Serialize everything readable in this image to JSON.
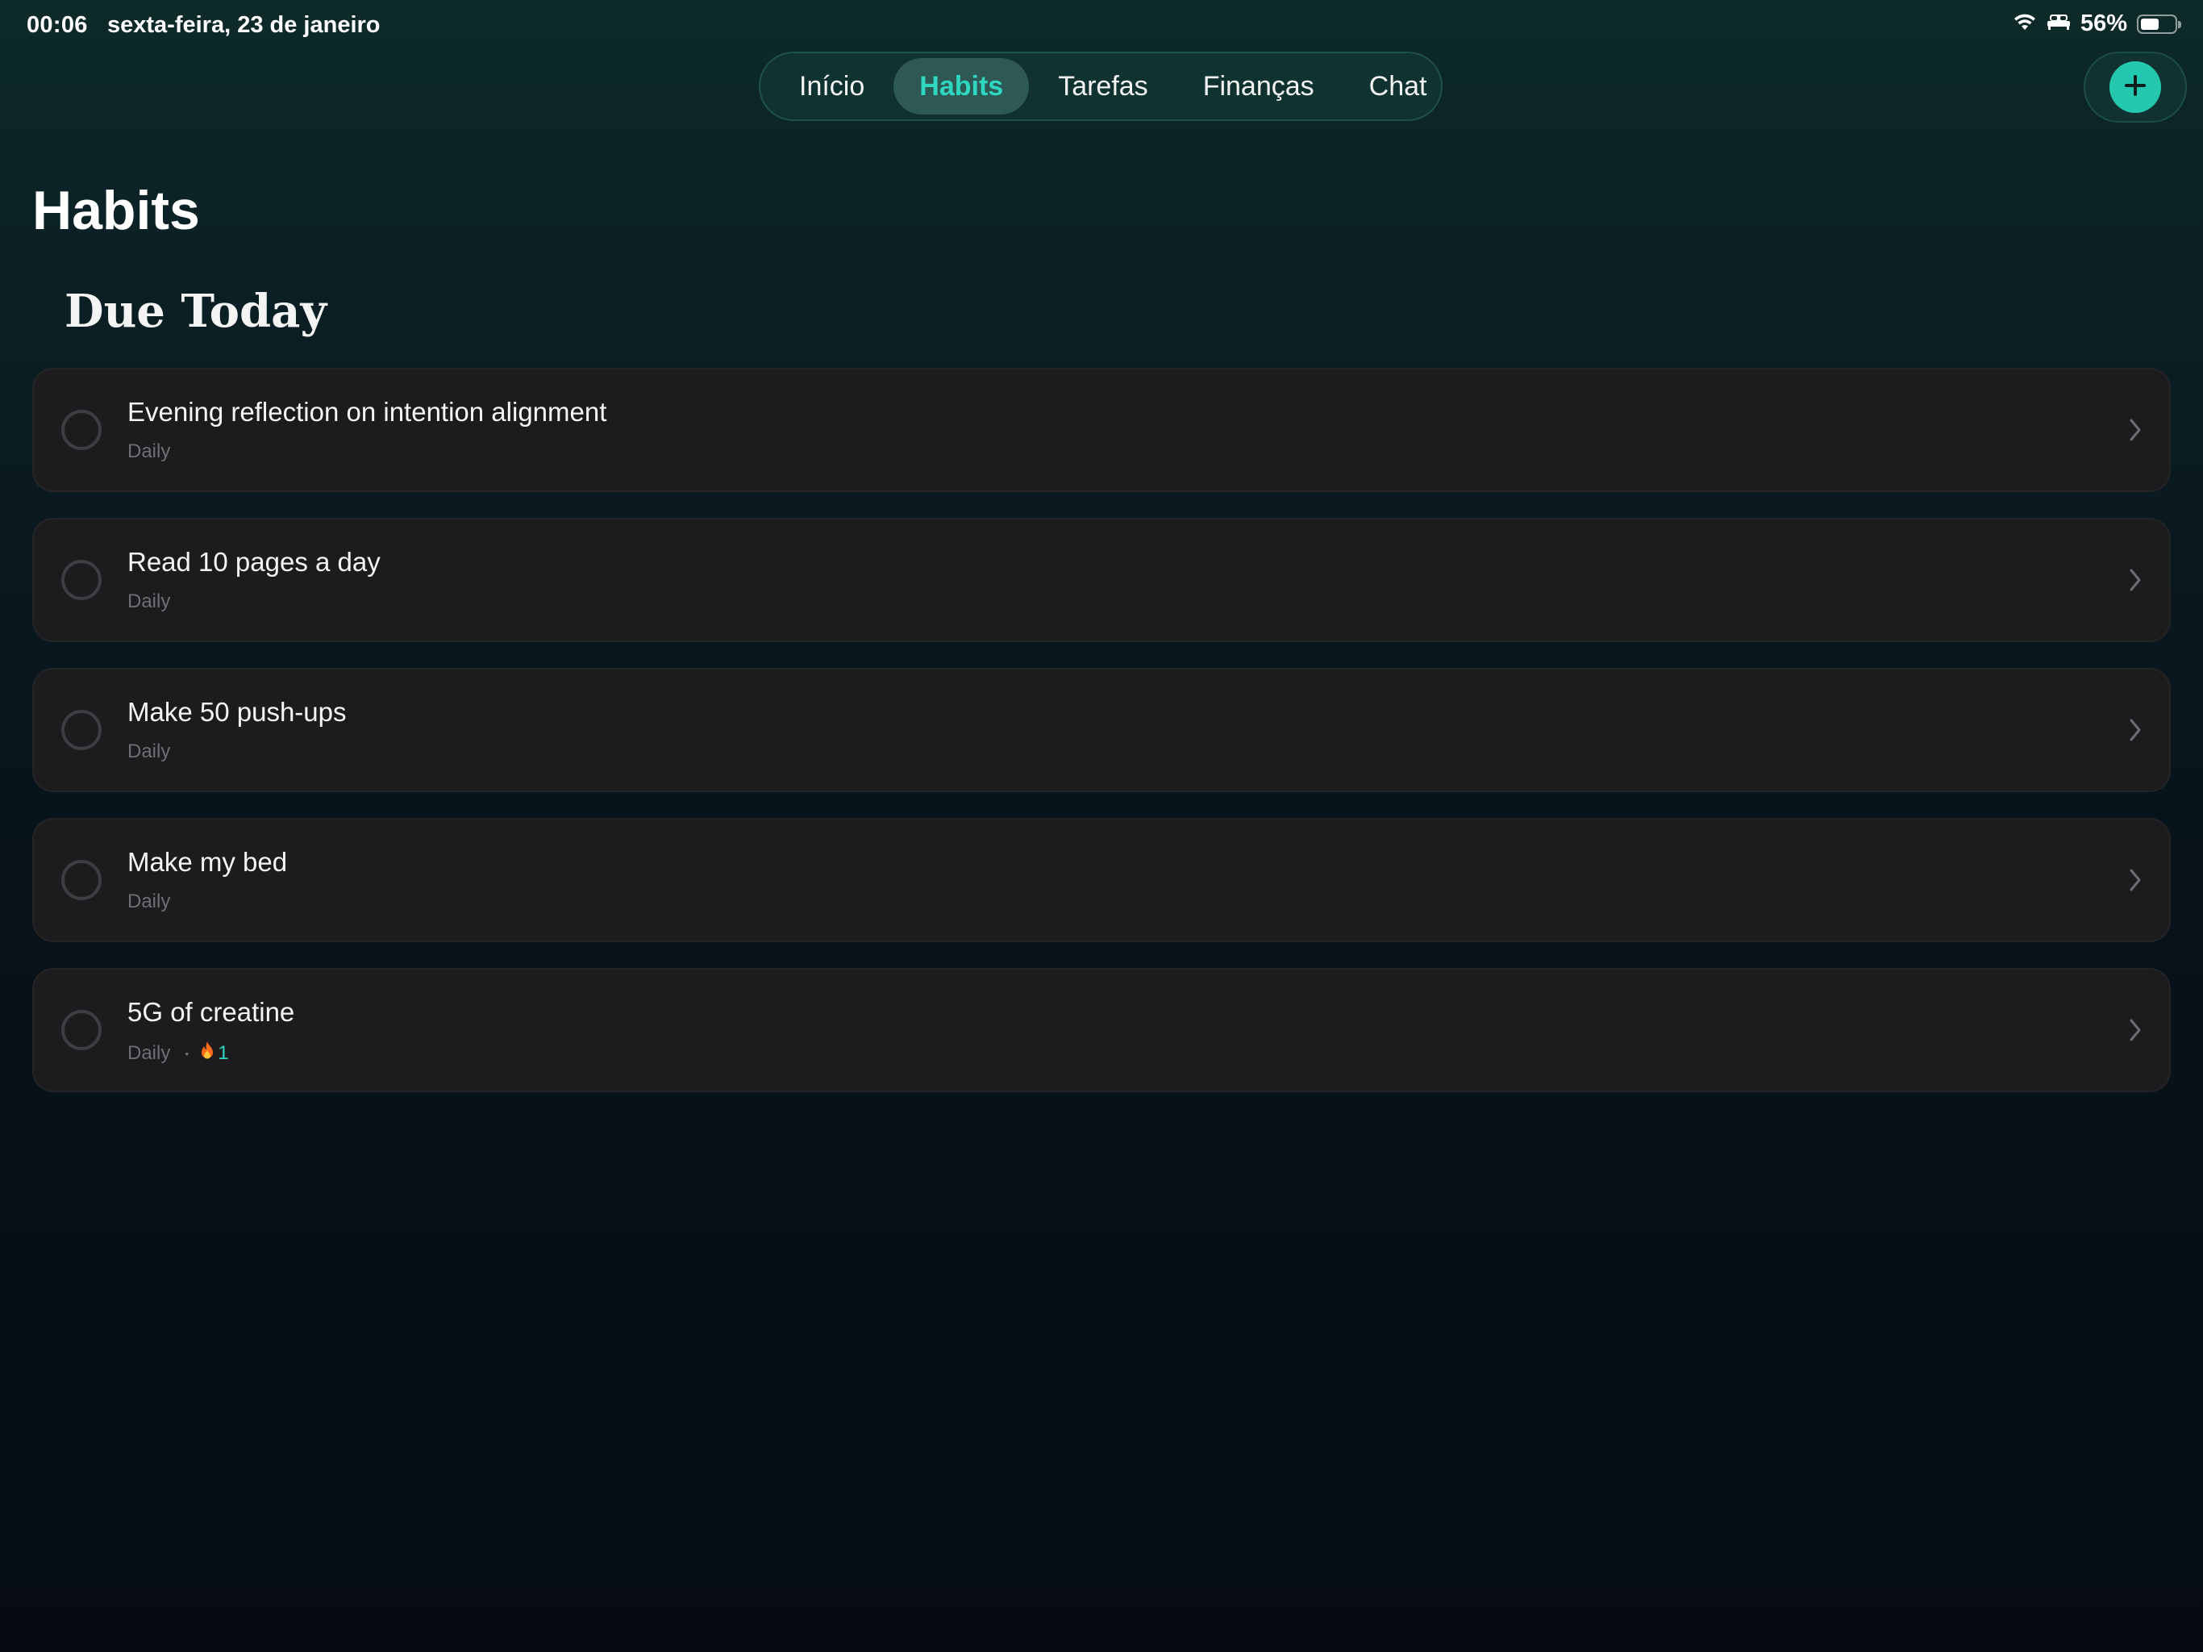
{
  "status_bar": {
    "time": "00:06",
    "date": "sexta-feira, 23 de janeiro",
    "battery_percent": "56%",
    "battery_level": 0.56,
    "icons": [
      "wifi-icon",
      "bed-icon",
      "battery-icon"
    ]
  },
  "nav": {
    "tabs": [
      {
        "label": "Início"
      },
      {
        "label": "Habits",
        "active": true
      },
      {
        "label": "Tarefas"
      },
      {
        "label": "Finanças"
      },
      {
        "label": "Chat"
      }
    ]
  },
  "add_button": {
    "icon": "plus-icon"
  },
  "page": {
    "title": "Habits",
    "section_title": "Due Today"
  },
  "habits": [
    {
      "name": "Evening reflection on intention alignment",
      "frequency": "Daily"
    },
    {
      "name": "Read 10 pages a day",
      "frequency": "Daily"
    },
    {
      "name": "Make 50 push-ups",
      "frequency": "Daily"
    },
    {
      "name": "Make my bed",
      "frequency": "Daily"
    },
    {
      "name": "5G of creatine",
      "frequency": "Daily",
      "separator": "•",
      "streak": "1",
      "streak_icon": "fire-icon"
    }
  ],
  "colors": {
    "accent": "#2fd6c0",
    "add_button": "#23c8ae",
    "card_bg": "#1c1c1e",
    "meta_text": "#6e6e73"
  }
}
